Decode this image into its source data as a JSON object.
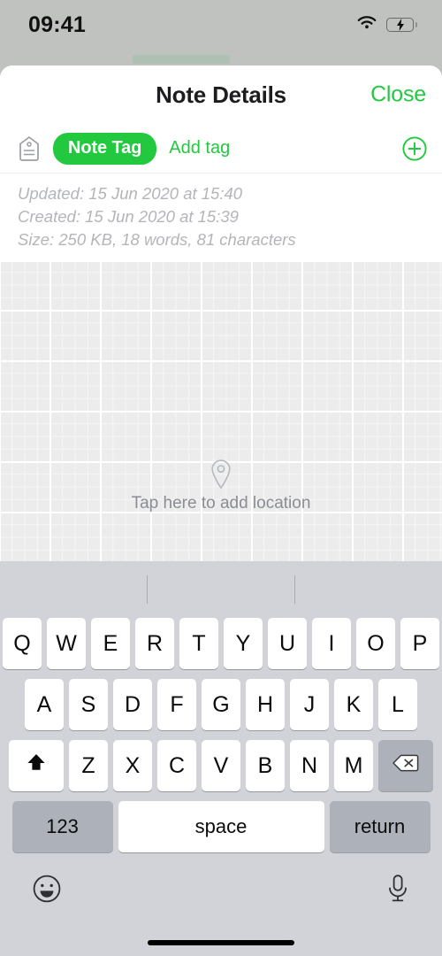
{
  "status_bar": {
    "time": "09:41",
    "wifi_icon": "wifi-icon",
    "battery_icon": "battery-charging-icon",
    "battery_charging": true
  },
  "sheet": {
    "title": "Note Details",
    "close_label": "Close"
  },
  "tag_row": {
    "tag_icon": "tag-icon",
    "tag_label": "Note Tag",
    "add_tag_label": "Add tag",
    "add_button_icon": "plus-circle-icon"
  },
  "metadata": {
    "updated": "Updated: 15 Jun 2020 at 15:40",
    "created": "Created: 15 Jun 2020 at 15:39",
    "size": "Size: 250 KB, 18 words, 81 characters"
  },
  "map": {
    "pin_icon": "map-pin-icon",
    "cta_label": "Tap here to add location"
  },
  "keyboard": {
    "row1": [
      "Q",
      "W",
      "E",
      "R",
      "T",
      "Y",
      "U",
      "I",
      "O",
      "P"
    ],
    "row2": [
      "A",
      "S",
      "D",
      "F",
      "G",
      "H",
      "J",
      "K",
      "L"
    ],
    "row3": [
      "Z",
      "X",
      "C",
      "V",
      "B",
      "N",
      "M"
    ],
    "shift_icon": "shift-up-arrow-icon",
    "backspace_icon": "backspace-delete-icon",
    "numeric_label": "123",
    "space_label": "space",
    "return_label": "return",
    "emoji_icon": "emoji-smiley-icon",
    "mic_icon": "microphone-icon"
  },
  "colors": {
    "accent_green": "#22c93f",
    "sheet_background": "#ffffff",
    "keyboard_background": "#d1d3d9",
    "key_background": "#ffffff",
    "key_dark_background": "#adb1b9",
    "meta_text": "#b3b5b9",
    "map_background": "#ececed",
    "backdrop": "#c0c2c0"
  }
}
